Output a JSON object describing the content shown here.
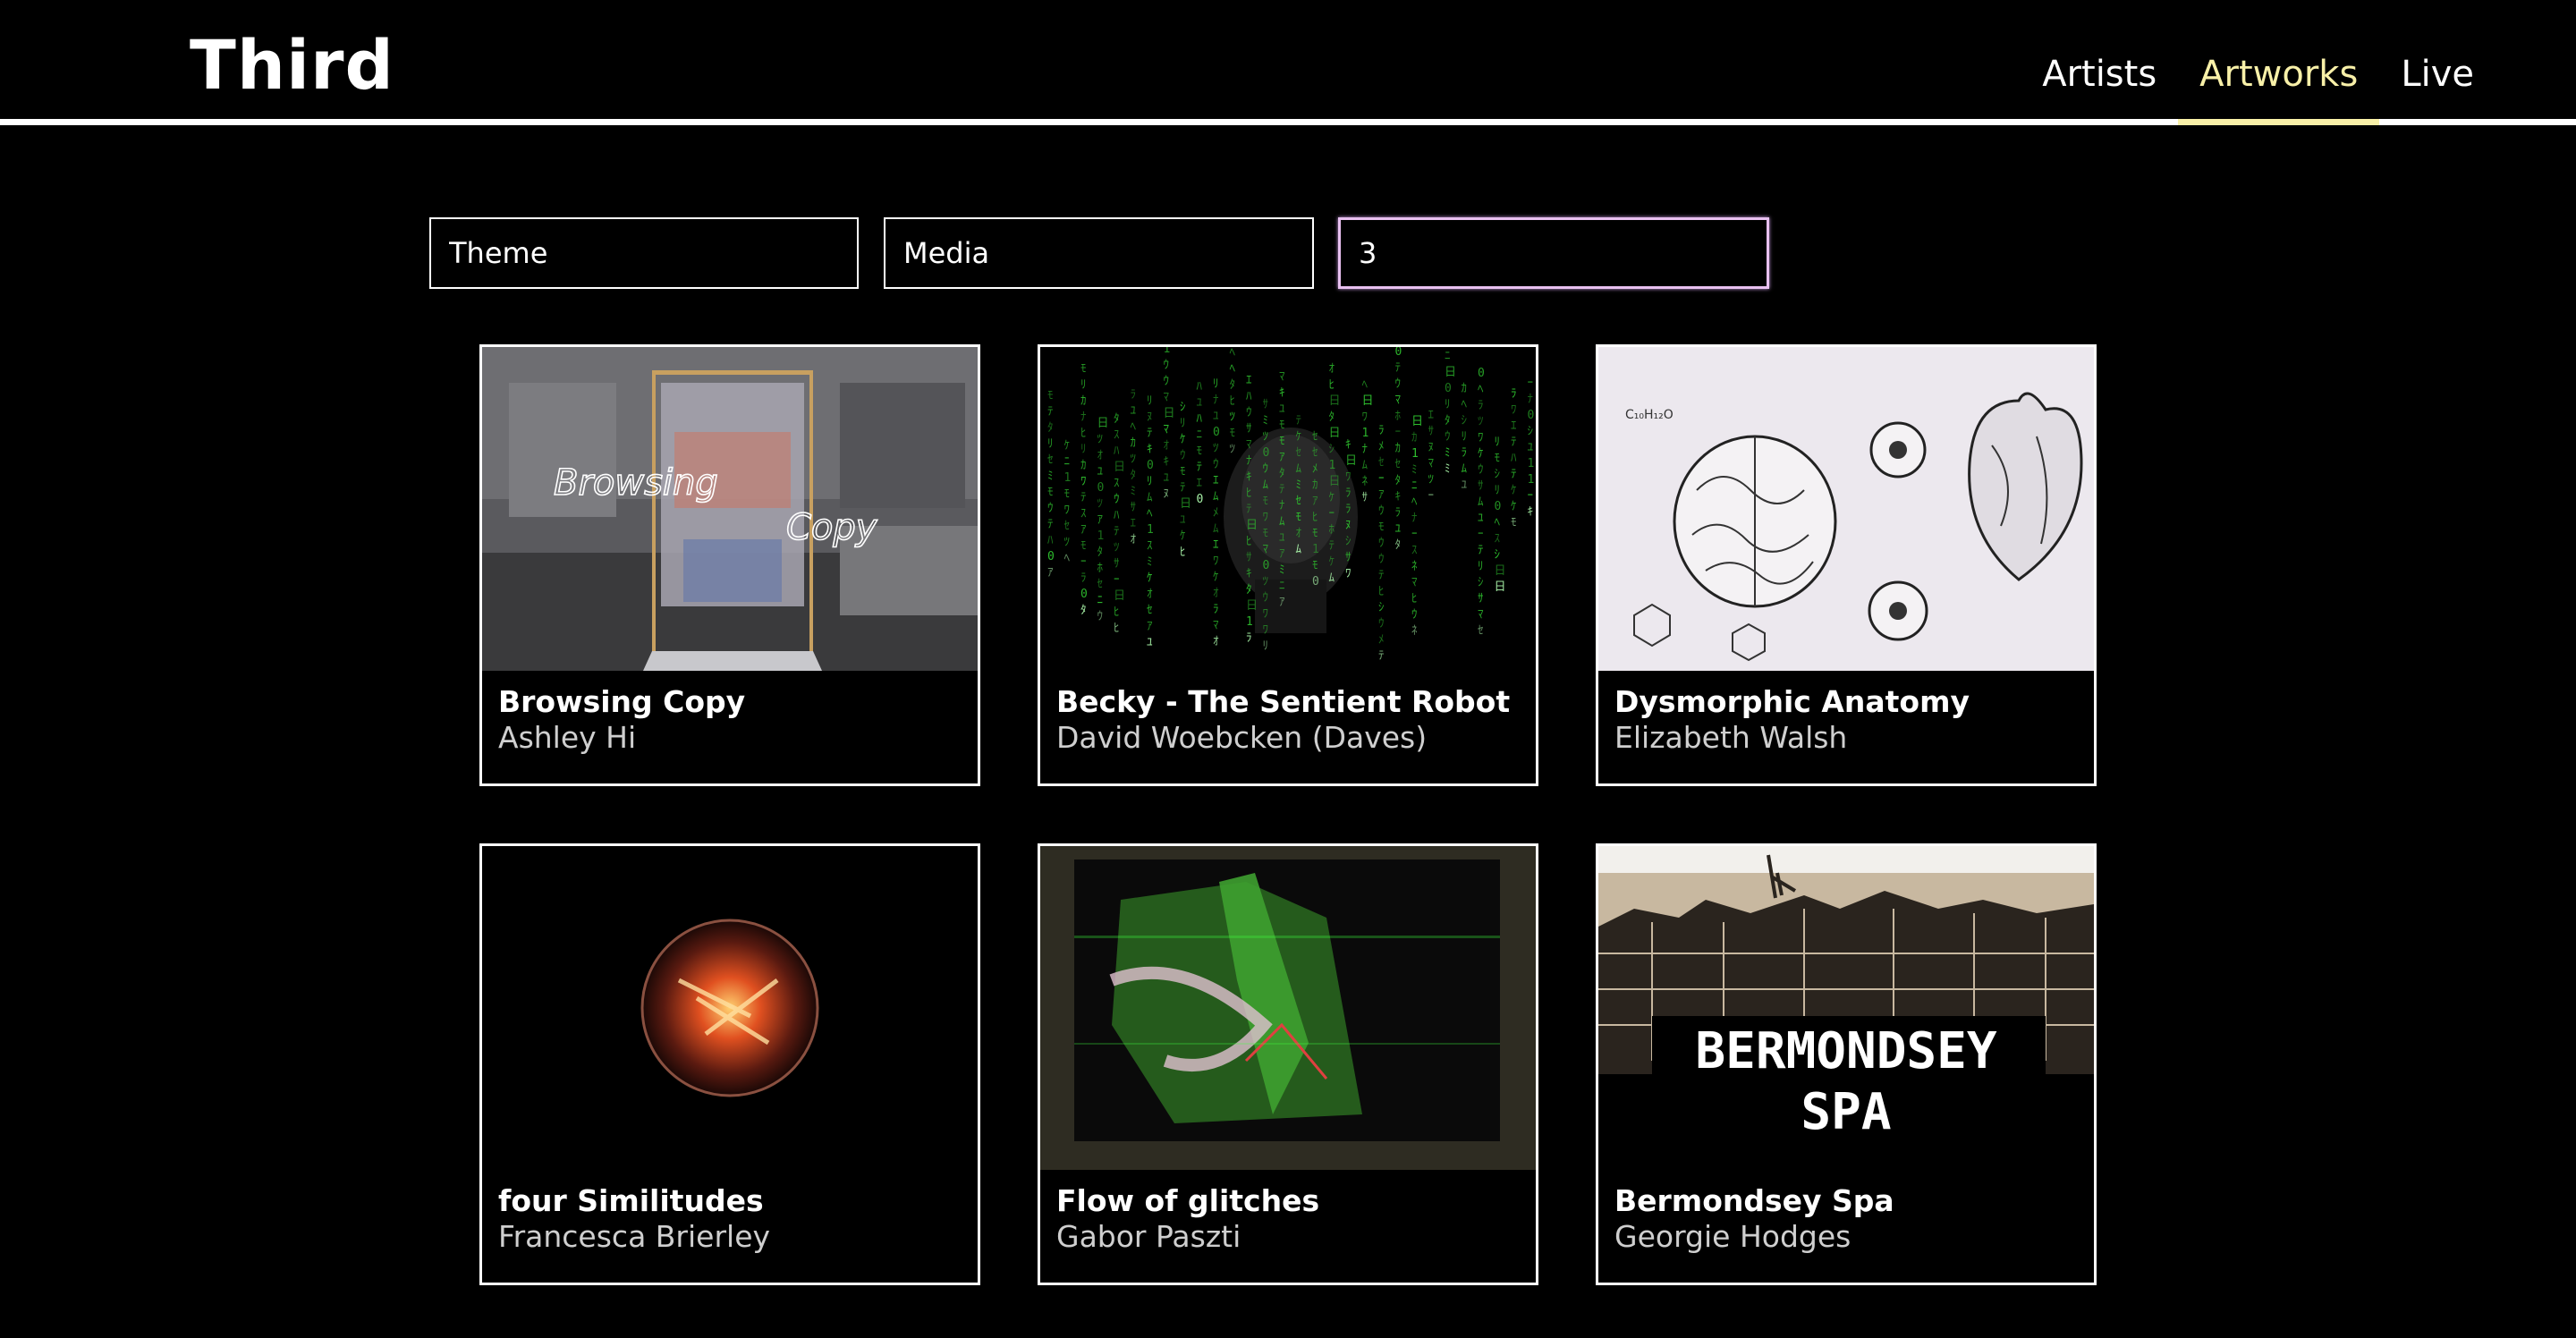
{
  "header": {
    "logo": "Third",
    "nav": [
      "Artists",
      "Artworks",
      "Live"
    ],
    "active_nav": "Artworks",
    "accent_color": "#f8f0a8"
  },
  "filters": {
    "theme_placeholder": "Theme",
    "media_placeholder": "Media",
    "year_value": "3",
    "focus_color": "#e8c0f0"
  },
  "artworks": [
    {
      "title": "Browsing Copy",
      "artist": "Ashley Hi",
      "overlay": [
        "Browsing",
        "Copy"
      ]
    },
    {
      "title": "Becky - The Sentient Robot",
      "artist": "David Woebcken (Daves)"
    },
    {
      "title": "Dysmorphic Anatomy",
      "artist": "Elizabeth Walsh"
    },
    {
      "title": "four Similitudes",
      "artist": "Francesca Brierley"
    },
    {
      "title": "Flow of glitches",
      "artist": "Gabor Paszti"
    },
    {
      "title": "Bermondsey Spa",
      "artist": "Georgie Hodges",
      "overlay": [
        "BERMONDSEY",
        "SPA"
      ]
    }
  ]
}
